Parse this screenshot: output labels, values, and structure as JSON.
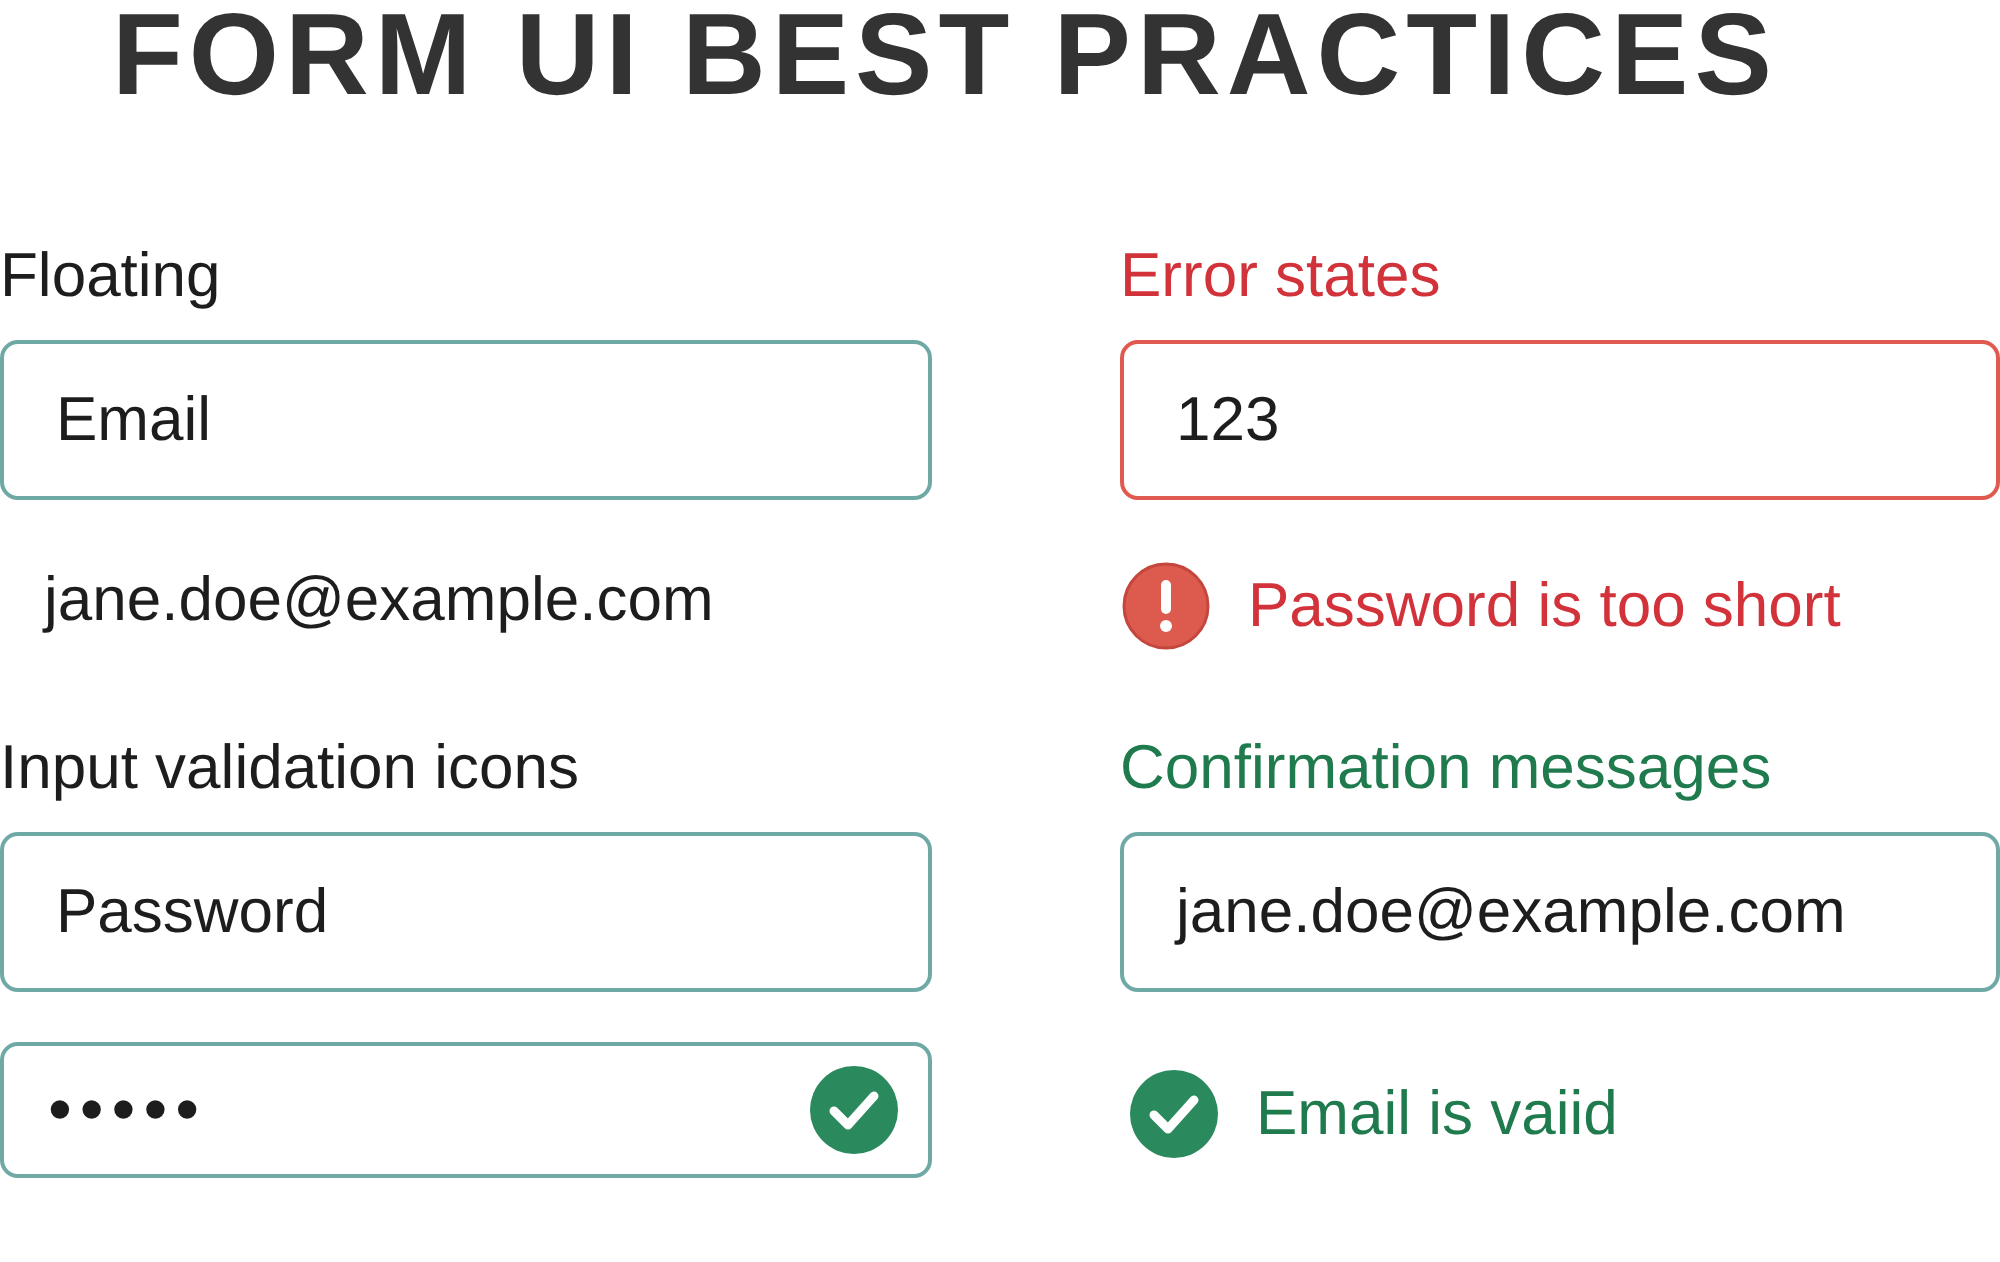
{
  "title": "FORM UI BEST PRACTICES",
  "sections": [
    {
      "kind": "neutral",
      "label": "Floating",
      "fields": [
        {
          "value": "Email",
          "masked": false,
          "valid": false
        }
      ],
      "note": {
        "kind": "helper",
        "text": "jane.doe@example.com"
      }
    },
    {
      "kind": "error",
      "label": "Error states",
      "fields": [
        {
          "value": "123",
          "masked": false,
          "valid": false
        }
      ],
      "note": {
        "kind": "error",
        "text": "Password is too short"
      }
    },
    {
      "kind": "neutral",
      "label": "Input validation icons",
      "fields": [
        {
          "value": "Password",
          "masked": false,
          "valid": false
        },
        {
          "value": "•••••",
          "masked": true,
          "valid": true
        }
      ]
    },
    {
      "kind": "success",
      "label": "Confirmation messages",
      "fields": [
        {
          "value": "jane.doe@example.com",
          "masked": false,
          "valid": false
        }
      ],
      "note": {
        "kind": "success",
        "text": "Email is vaiid"
      }
    }
  ]
}
